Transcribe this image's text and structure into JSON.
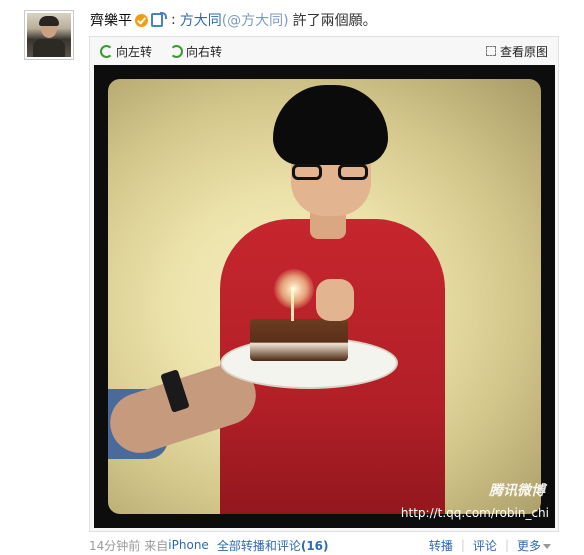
{
  "post": {
    "author": "齊樂平",
    "colon": ":",
    "mention_name": "方大同",
    "mention_handle": "(@方大同)",
    "text": "許了兩個願。"
  },
  "media": {
    "rotate_left_label": "向左转",
    "rotate_right_label": "向右转",
    "view_original_label": "查看原图",
    "watermark_logo": "腾讯微博",
    "watermark_url": "http://t.qq.com/robin_chi"
  },
  "meta": {
    "time": "14分钟前",
    "source_prefix": "来自",
    "source": "iPhone",
    "all_label": "全部转播和评论",
    "all_count": "(16)",
    "actions": {
      "repost": "转播",
      "comment": "评论",
      "more": "更多"
    }
  },
  "colors": {
    "link": "#2f6ab0",
    "verified": "#f39c12",
    "rotate_icon": "#3a9a2f"
  },
  "icons": [
    "verified-icon",
    "phone-icon",
    "rotate-left-icon",
    "rotate-right-icon",
    "expand-icon",
    "chevron-down-icon"
  ]
}
